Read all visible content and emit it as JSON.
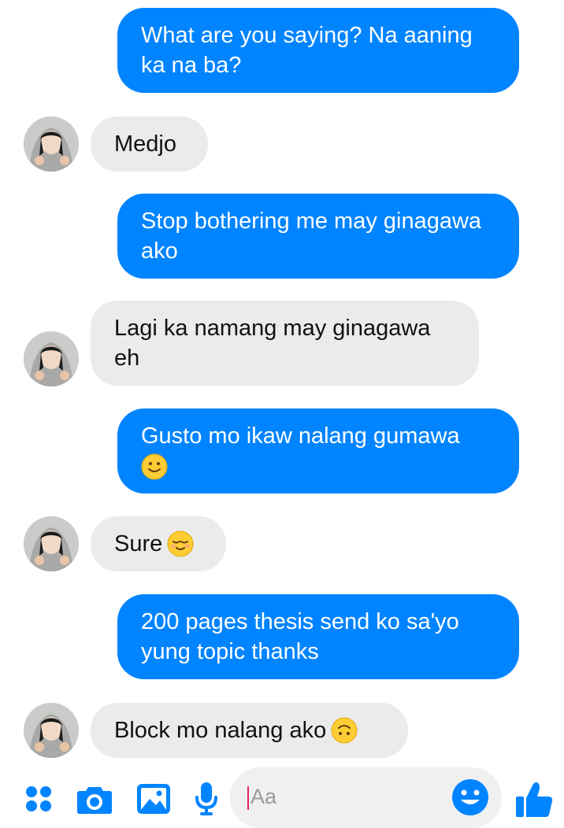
{
  "conversation": {
    "messages": [
      {
        "sender": "me",
        "text": "What are you saying? Na aaning ka na ba?"
      },
      {
        "sender": "them",
        "text": "Medjo"
      },
      {
        "sender": "me",
        "text": "Stop bothering me may ginagawa ako"
      },
      {
        "sender": "them",
        "text": "Lagi ka namang may ginagawa eh"
      },
      {
        "sender": "me",
        "text": "Gusto mo ikaw nalang gumawa",
        "emoji": "slightly-smiling-face"
      },
      {
        "sender": "them",
        "text": "Sure",
        "emoji": "relieved-face"
      },
      {
        "sender": "me",
        "text": "200 pages thesis send ko sa'yo yung topic thanks"
      },
      {
        "sender": "them",
        "text": "Block mo nalang ako",
        "emoji": "upside-down-face"
      }
    ]
  },
  "composer": {
    "placeholder": "Aa",
    "icons": [
      "apps-grid-icon",
      "camera-icon",
      "image-icon",
      "microphone-icon",
      "emoji-icon",
      "like-thumbs-up-icon"
    ],
    "accent_color": "#0084ff"
  },
  "colors": {
    "sent_bubble": "#0084ff",
    "received_bubble": "#ebebeb"
  }
}
